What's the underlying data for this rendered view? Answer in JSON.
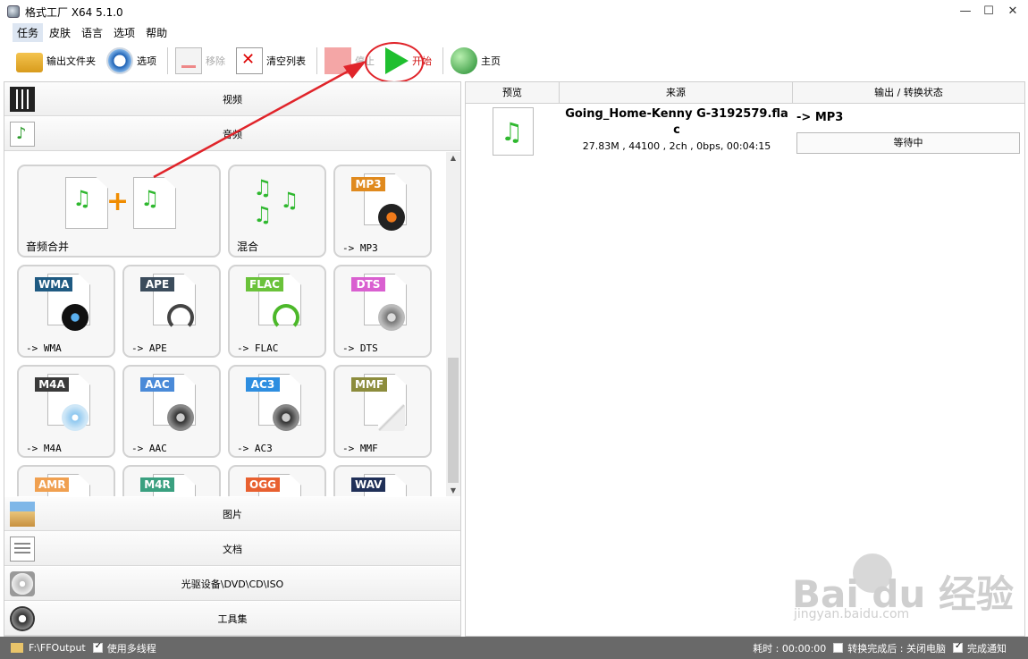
{
  "window": {
    "title": "格式工厂 X64 5.1.0",
    "controls": [
      "—",
      "☐",
      "✕"
    ]
  },
  "menu": [
    "任务",
    "皮肤",
    "语言",
    "选项",
    "帮助"
  ],
  "toolbar": {
    "output_folder": "输出文件夹",
    "options": "选项",
    "remove": "移除",
    "clear_list": "清空列表",
    "stop": "停止",
    "start": "开始",
    "home": "主页"
  },
  "categories": {
    "video": "视频",
    "audio": "音频",
    "picture": "图片",
    "document": "文档",
    "disc": "光驱设备\\DVD\\CD\\ISO",
    "tools": "工具集"
  },
  "tiles": [
    {
      "label": "音频合并"
    },
    {
      "label": "混合"
    },
    {
      "label": "-> MP3",
      "badge": "MP3",
      "color": "#e08a1e"
    },
    {
      "label": "-> WMA",
      "badge": "WMA",
      "color": "#1f5a82"
    },
    {
      "label": "-> APE",
      "badge": "APE",
      "color": "#3b4c5c"
    },
    {
      "label": "-> FLAC",
      "badge": "FLAC",
      "color": "#6ac23a"
    },
    {
      "label": "-> DTS",
      "badge": "DTS",
      "color": "#d95fd0"
    },
    {
      "label": "-> M4A",
      "badge": "M4A",
      "color": "#3a3a3a"
    },
    {
      "label": "-> AAC",
      "badge": "AAC",
      "color": "#4a8ad8"
    },
    {
      "label": "-> AC3",
      "badge": "AC3",
      "color": "#2e8ee0"
    },
    {
      "label": "-> MMF",
      "badge": "MMF",
      "color": "#8c8c3c"
    },
    {
      "badge": "AMR",
      "color": "#f0a050"
    },
    {
      "badge": "M4R",
      "color": "#3aa080"
    },
    {
      "badge": "OGG",
      "color": "#e86030"
    },
    {
      "badge": "WAV",
      "color": "#203058"
    }
  ],
  "table": {
    "headers": [
      "预览",
      "来源",
      "输出 / 转换状态"
    ],
    "rows": [
      {
        "source": "Going_Home-Kenny G-3192579.flac",
        "info": "27.83M , 44100 , 2ch , 0bps, 00:04:15",
        "output": "-> MP3",
        "status": "等待中"
      }
    ]
  },
  "watermark": {
    "main": "Bai du 经验",
    "sub": "jingyan.baidu.com"
  },
  "statusbar": {
    "output_path": "F:\\FFOutput",
    "multithread": "使用多线程",
    "elapsed": "耗时 : 00:00:00",
    "after_convert": "转换完成后 : 关闭电脑",
    "notify": "完成通知"
  }
}
